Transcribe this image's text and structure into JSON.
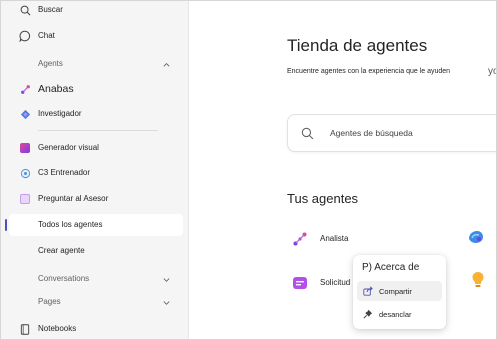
{
  "sidebar": {
    "search_label": "Buscar",
    "chat_label": "Chat",
    "agents_header": "Agents",
    "agents": [
      {
        "label": "Anabas",
        "icon": "anabas-icon"
      },
      {
        "label": "Investigador",
        "icon": "investigador-icon"
      }
    ],
    "pinned": [
      {
        "label": "Generador visual",
        "icon": "generador-visual-icon"
      },
      {
        "label": "C3 Entrenador",
        "icon": "entrenador-icon"
      },
      {
        "label": "Preguntar al Asesor",
        "icon": "asesor-icon"
      }
    ],
    "all_agents_label": "Todos los agentes",
    "create_agent_label": "Crear agente",
    "conversations_header": "Conversations",
    "pages_header": "Pages",
    "notebooks_label": "Notebooks"
  },
  "main": {
    "title": "Tienda de agentes",
    "subtitle": "Encuentre agentes con la experiencia que le ayuden",
    "clipped_text": "yo",
    "search": {
      "placeholder": "Agentes de búsqueda"
    },
    "your_agents_title": "Tus agentes",
    "agents": [
      {
        "label": "Analista",
        "icon": "analista-icon"
      },
      {
        "label": "Solicitud",
        "icon": "solicitud-icon"
      }
    ]
  },
  "context_menu": {
    "header": "P) Acerca de",
    "items": [
      {
        "label": "Compartir",
        "icon": "share-icon"
      },
      {
        "label": "desanclar",
        "icon": "unpin-icon"
      }
    ]
  },
  "colors": {
    "accent": "#4f52b2",
    "sidebar_bg": "#f5f5f5"
  }
}
